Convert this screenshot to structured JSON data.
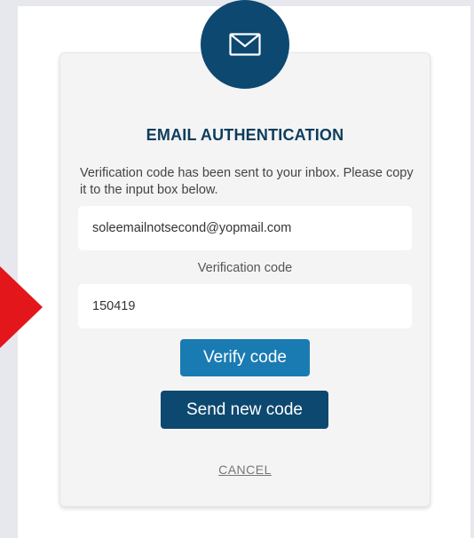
{
  "title": "EMAIL AUTHENTICATION",
  "description": "Verification code has been sent to your inbox. Please copy it to the input box below.",
  "email": {
    "value": "soleemailnotsecond@yopmail.com"
  },
  "code": {
    "label": "Verification code",
    "value": "150419"
  },
  "buttons": {
    "verify_label": "Verify code",
    "send_label": "Send new code",
    "cancel_label": "CANCEL"
  },
  "icons": {
    "header": "envelope-icon",
    "pointer": "arrow-right-icon"
  },
  "colors": {
    "primary_dark": "#0d4870",
    "primary": "#1a7bb3",
    "title": "#0d3d5c",
    "card_bg": "#f4f4f4",
    "page_bg": "#e7e8ed",
    "arrow": "#e3161c"
  }
}
